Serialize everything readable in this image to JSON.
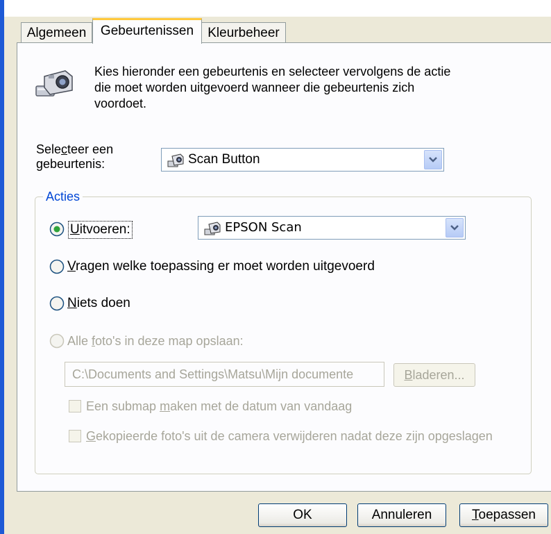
{
  "tabs": [
    "Algemeen",
    "Gebeurtenissen",
    "Kleurbeheer"
  ],
  "intro": {
    "line1": "Kies hieronder een gebeurtenis en selecteer vervolgens de actie",
    "line2": "die moet worden uitgevoerd wanneer die gebeurtenis zich",
    "line3": "voordoet.",
    "icon": "camera-scanner-icon"
  },
  "event_select": {
    "label_line1_a": "Sele",
    "label_line1_u": "c",
    "label_line1_b": "teer een",
    "label_line2": "gebeurtenis:",
    "value": "Scan Button",
    "icon": "scanner-icon"
  },
  "actions": {
    "title": "Acties",
    "run": {
      "label_u": "U",
      "label_rest": "itvoeren:",
      "selected": true,
      "app": "EPSON Scan",
      "app_icon": "scanner-icon"
    },
    "ask": {
      "label_u": "V",
      "label_rest": "ragen welke toepassing er moet worden uitgevoerd",
      "selected": false
    },
    "nothing": {
      "label_u": "N",
      "label_rest": "iets doen",
      "selected": false
    },
    "save": {
      "label_a": "Alle ",
      "label_u": "f",
      "label_b": "oto's in deze map opslaan:",
      "enabled": false
    },
    "path": "C:\\Documents and Settings\\Matsu\\Mijn documente",
    "browse": {
      "label_u": "B",
      "label_rest": "laderen..."
    },
    "subfolder": {
      "label_a": "Een submap ",
      "label_u": "m",
      "label_b": "aken met de datum van vandaag",
      "checked": false
    },
    "delete": {
      "label_u": "G",
      "label_rest": "ekopieerde foto's uit de camera verwijderen nadat deze zijn opgeslagen",
      "checked": false
    }
  },
  "buttons": {
    "ok": "OK",
    "cancel": "Annuleren",
    "apply_u": "T",
    "apply_rest": "oepassen"
  },
  "colors": {
    "accent": "#0046d5",
    "tab_highlight": "#ffc83c",
    "radio_dot": "#2fa33b",
    "disabled_text": "#a7a69a"
  }
}
